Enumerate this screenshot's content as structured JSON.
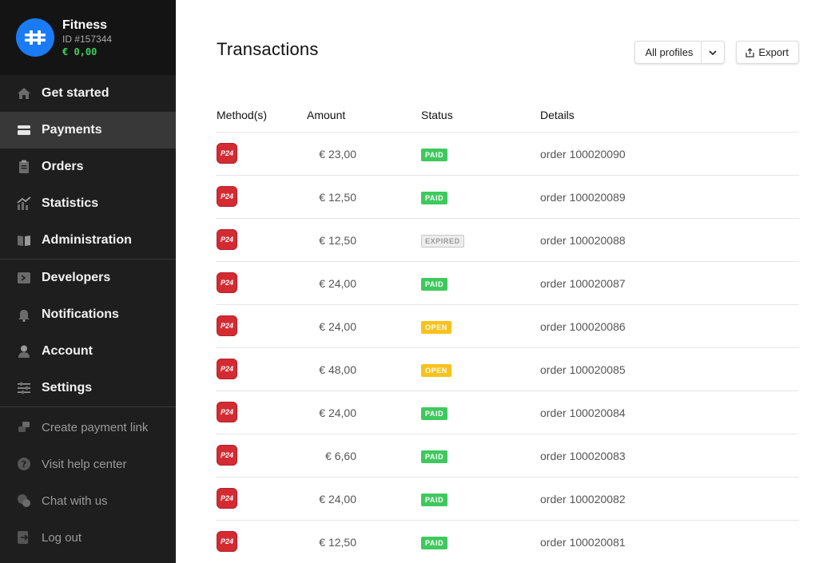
{
  "account": {
    "name": "Fitness",
    "id_label": "ID #157344",
    "balance": "€ 0,00",
    "avatar_color": "#1a7cf5"
  },
  "sidebar": {
    "primary": [
      {
        "label": "Get started",
        "icon": "home-icon"
      },
      {
        "label": "Payments",
        "icon": "payments-icon",
        "active": true
      },
      {
        "label": "Orders",
        "icon": "orders-icon"
      },
      {
        "label": "Statistics",
        "icon": "statistics-icon"
      },
      {
        "label": "Administration",
        "icon": "administration-icon"
      }
    ],
    "secondary": [
      {
        "label": "Developers",
        "icon": "developers-icon"
      },
      {
        "label": "Notifications",
        "icon": "bell-icon"
      },
      {
        "label": "Account",
        "icon": "user-icon"
      },
      {
        "label": "Settings",
        "icon": "sliders-icon"
      }
    ],
    "tertiary": [
      {
        "label": "Create payment link",
        "icon": "payment-link-icon"
      },
      {
        "label": "Visit help center",
        "icon": "help-icon"
      },
      {
        "label": "Chat with us",
        "icon": "chat-icon"
      },
      {
        "label": "Log out",
        "icon": "logout-icon"
      }
    ]
  },
  "header": {
    "title": "Transactions",
    "profile_filter": "All profiles",
    "export_label": "Export"
  },
  "table": {
    "columns": [
      "Method(s)",
      "Amount",
      "Status",
      "Details"
    ],
    "rows": [
      {
        "method": "P24",
        "amount": "€ 23,00",
        "status": "PAID",
        "details": "order 100020090"
      },
      {
        "method": "P24",
        "amount": "€ 12,50",
        "status": "PAID",
        "details": "order 100020089"
      },
      {
        "method": "P24",
        "amount": "€ 12,50",
        "status": "EXPIRED",
        "details": "order 100020088"
      },
      {
        "method": "P24",
        "amount": "€ 24,00",
        "status": "PAID",
        "details": "order 100020087"
      },
      {
        "method": "P24",
        "amount": "€ 24,00",
        "status": "OPEN",
        "details": "order 100020086"
      },
      {
        "method": "P24",
        "amount": "€ 48,00",
        "status": "OPEN",
        "details": "order 100020085"
      },
      {
        "method": "P24",
        "amount": "€ 24,00",
        "status": "PAID",
        "details": "order 100020084"
      },
      {
        "method": "P24",
        "amount": "€ 6,60",
        "status": "PAID",
        "details": "order 100020083"
      },
      {
        "method": "P24",
        "amount": "€ 24,00",
        "status": "PAID",
        "details": "order 100020082"
      },
      {
        "method": "P24",
        "amount": "€ 12,50",
        "status": "PAID",
        "details": "order 100020081"
      }
    ]
  },
  "colors": {
    "sidebar_bg": "#1e1e1e",
    "paid": "#3ec95d",
    "open": "#f7c21c",
    "p24_red": "#d42b33",
    "balance_green": "#3ecf5c"
  }
}
